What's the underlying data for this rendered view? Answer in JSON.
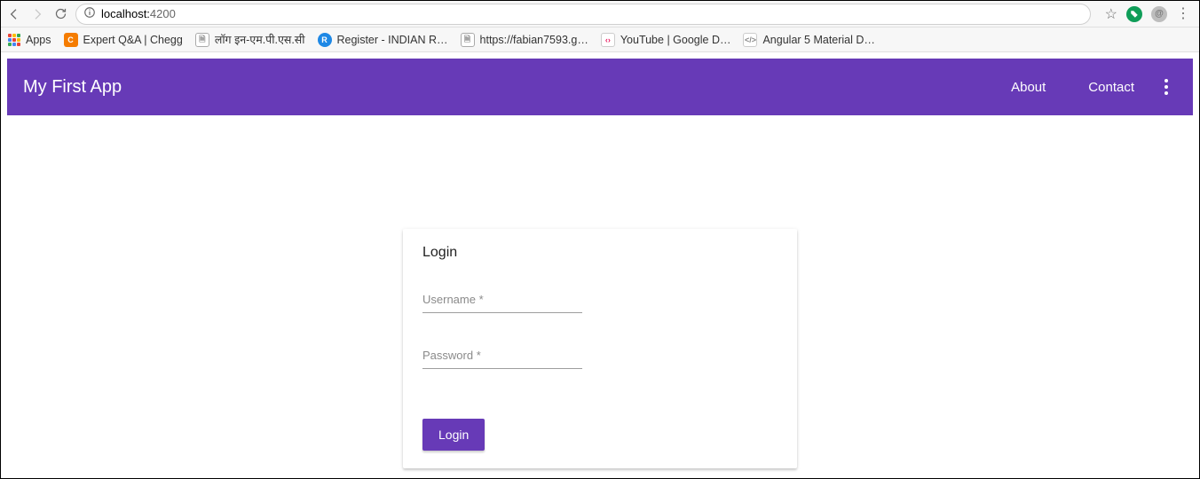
{
  "browser": {
    "url_host": "localhost:",
    "url_port": "4200",
    "bookmarks_label_apps": "Apps",
    "bookmarks": [
      {
        "label": "Expert Q&A | Chegg",
        "icon": "orange"
      },
      {
        "label": "लॉग इन-एम.पी.एस.सी",
        "icon": "doc"
      },
      {
        "label": "Register - INDIAN R…",
        "icon": "blue"
      },
      {
        "label": "https://fabian7593.g…",
        "icon": "doc"
      },
      {
        "label": "YouTube  |  Google D…",
        "icon": "brackets"
      },
      {
        "label": "Angular 5 Material D…",
        "icon": "ang"
      }
    ]
  },
  "app": {
    "title": "My First App",
    "nav": {
      "about": "About",
      "contact": "Contact"
    }
  },
  "login": {
    "title": "Login",
    "username_label": "Username *",
    "password_label": "Password *",
    "submit_label": "Login"
  }
}
